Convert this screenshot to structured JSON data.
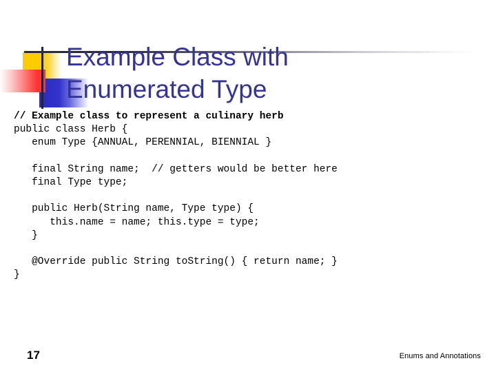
{
  "slide": {
    "title": "Example Class with\nEnumerated Type",
    "title_color": "#333399",
    "page_number": "17",
    "footer": "Enums and Annotations",
    "background_color": "#ffffff"
  },
  "decoration": {
    "yellow_color": "#ffcc00",
    "blue_color": "#3333cc",
    "red_color": "#ff3333",
    "line_color": "#2b2b3d"
  },
  "code": {
    "language": "java",
    "lines": [
      {
        "text": "// Example class to represent a culinary herb",
        "bold": true
      },
      {
        "text": "public class Herb {",
        "bold": false
      },
      {
        "text": "   enum Type {ANNUAL, PERENNIAL, BIENNIAL }",
        "bold": false
      },
      {
        "text": "",
        "bold": false
      },
      {
        "text": "   final String name;  // getters would be better here",
        "bold": false
      },
      {
        "text": "   final Type type;",
        "bold": false
      },
      {
        "text": "",
        "bold": false
      },
      {
        "text": "   public Herb(String name, Type type) {",
        "bold": false
      },
      {
        "text": "      this.name = name; this.type = type;",
        "bold": false
      },
      {
        "text": "   }",
        "bold": false
      },
      {
        "text": "",
        "bold": false
      },
      {
        "text": "   @Override public String toString() { return name; }",
        "bold": false
      },
      {
        "text": "}",
        "bold": false
      }
    ]
  }
}
